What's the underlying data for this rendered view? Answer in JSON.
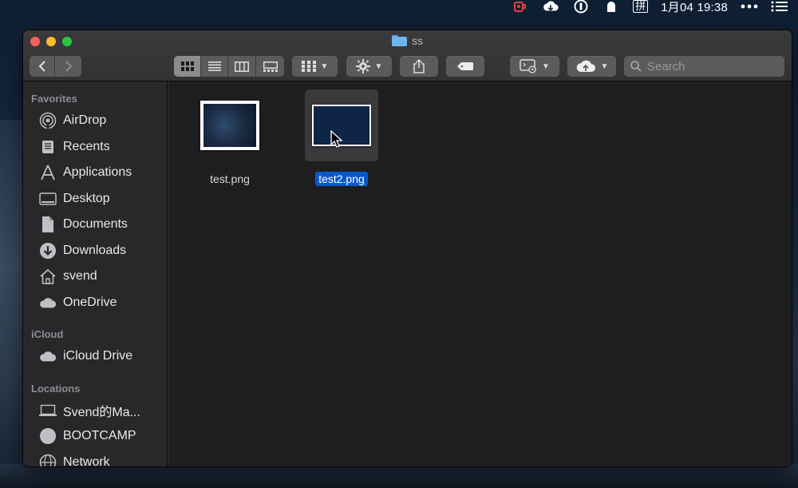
{
  "menubar": {
    "clock": "1月04 19:38",
    "input_method": "拼",
    "icons": [
      "status-cup-icon",
      "cloud-sync-icon",
      "password-icon",
      "ghost-icon",
      "more-dots-icon",
      "list-menu-icon"
    ]
  },
  "window": {
    "title": "ss"
  },
  "toolbar": {
    "search_placeholder": "Search",
    "view_modes": [
      "icon-view",
      "list-view",
      "column-view",
      "gallery-view"
    ]
  },
  "sidebar": {
    "sections": [
      {
        "label": "Favorites",
        "items": [
          {
            "label": "AirDrop",
            "icon": "airdrop-icon"
          },
          {
            "label": "Recents",
            "icon": "recents-icon"
          },
          {
            "label": "Applications",
            "icon": "applications-icon"
          },
          {
            "label": "Desktop",
            "icon": "desktop-icon"
          },
          {
            "label": "Documents",
            "icon": "documents-icon"
          },
          {
            "label": "Downloads",
            "icon": "downloads-icon"
          },
          {
            "label": "svend",
            "icon": "home-icon"
          },
          {
            "label": "OneDrive",
            "icon": "cloud-icon"
          }
        ]
      },
      {
        "label": "iCloud",
        "items": [
          {
            "label": "iCloud Drive",
            "icon": "icloud-icon"
          }
        ]
      },
      {
        "label": "Locations",
        "items": [
          {
            "label": "Svend的Ma...",
            "icon": "laptop-icon"
          },
          {
            "label": "BOOTCAMP",
            "icon": "disk-icon"
          },
          {
            "label": "Network",
            "icon": "network-icon"
          }
        ]
      }
    ]
  },
  "files": [
    {
      "name": "test.png",
      "selected": false
    },
    {
      "name": "test2.png",
      "selected": true
    }
  ],
  "colors": {
    "selection": "#0a58ca",
    "window_bg": "#1e1e21",
    "sidebar_bg": "#28282b"
  }
}
